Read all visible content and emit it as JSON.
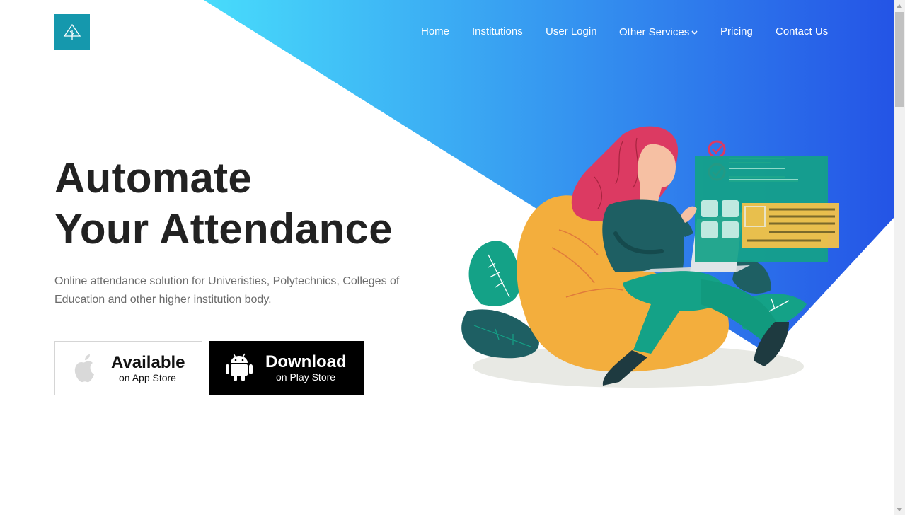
{
  "brand": {
    "logo_icon": "tree-outline-icon",
    "logo_color": "#1598ad"
  },
  "nav": {
    "items": [
      {
        "label": "Home"
      },
      {
        "label": "Institutions"
      },
      {
        "label": "User Login"
      },
      {
        "label": "Other Services",
        "has_dropdown": true
      },
      {
        "label": "Pricing"
      },
      {
        "label": "Contact Us"
      }
    ]
  },
  "hero": {
    "headline_line1": "Automate",
    "headline_line2": "Your Attendance",
    "description": "Online attendance solution for Univeristies, Polytechnics, Colleges of Education and other higher institution body.",
    "gradient_start": "#48dcfb",
    "gradient_end": "#2454e6"
  },
  "buttons": {
    "app_store": {
      "title": "Available",
      "subtitle": "on App Store",
      "icon": "apple-icon"
    },
    "play_store": {
      "title": "Download",
      "subtitle": "on Play Store",
      "icon": "android-icon"
    }
  }
}
